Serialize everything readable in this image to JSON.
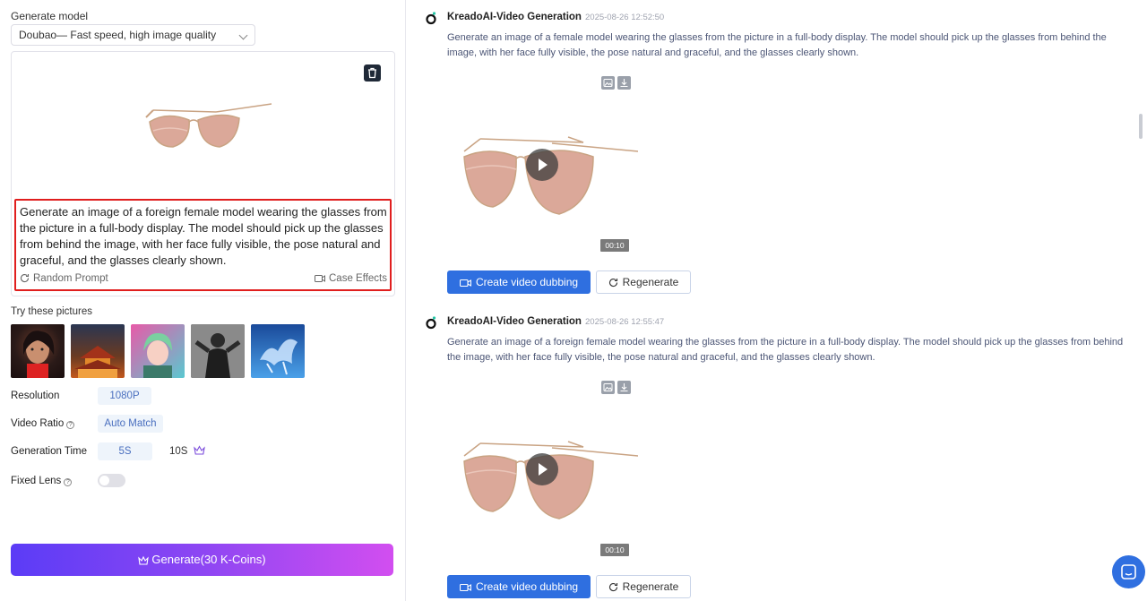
{
  "settings": {
    "model_label": "Generate model",
    "model_value": "Doubao— Fast speed, high image quality",
    "prompt_text": "Generate an image of a foreign female model wearing the glasses from the picture in a full-body display. The model should pick up the glasses from behind the image, with her face fully visible, the pose natural and graceful, and the glasses clearly shown.",
    "random_prompt_label": "Random Prompt",
    "case_effects_label": "Case Effects",
    "try_label": "Try these pictures",
    "resolution_label": "Resolution",
    "resolution_value": "1080P",
    "ratio_label": "Video Ratio",
    "ratio_value": "Auto Match",
    "time_label": "Generation Time",
    "time_option_1": "5S",
    "time_option_2": "10S",
    "fixed_lens_label": "Fixed Lens",
    "fixed_lens_on": false,
    "generate_label": "Generate(30 K-Coins)"
  },
  "feed": [
    {
      "name": "KreadoAI-Video Generation",
      "time": "2025-08-26 12:52:50",
      "desc": "Generate an image of a female model wearing the glasses from the picture in a full-body display. The model should pick up the glasses from behind the image, with her face fully visible, the pose natural and graceful, and the glasses clearly shown.",
      "duration": "00:10",
      "dub_label": "Create video dubbing",
      "regen_label": "Regenerate"
    },
    {
      "name": "KreadoAI-Video Generation",
      "time": "2025-08-26 12:55:47",
      "desc": "Generate an image of a foreign female model wearing the glasses from the picture in a full-body display. The model should pick up the glasses from behind the image, with her face fully visible, the pose natural and graceful, and the glasses clearly shown.",
      "duration": "00:10",
      "dub_label": "Create video dubbing",
      "regen_label": "Regenerate"
    }
  ],
  "colors": {
    "accent_blue": "#2f6fe0",
    "prompt_border": "#e01e1e",
    "generate_gradient_start": "#5b3cf6",
    "generate_gradient_end": "#d24ef0"
  }
}
